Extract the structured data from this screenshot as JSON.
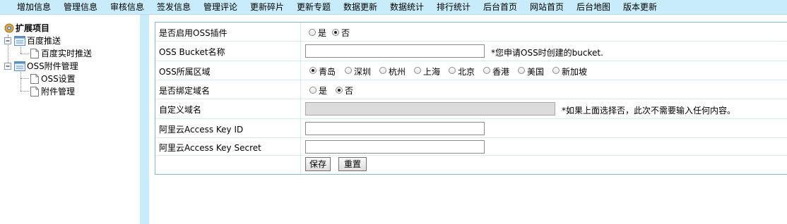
{
  "topnav": {
    "items": [
      "增加信息",
      "管理信息",
      "审核信息",
      "签发信息",
      "管理评论",
      "更新碎片",
      "更新专题",
      "数据更新",
      "数据统计",
      "排行统计",
      "后台首页",
      "网站首页",
      "后台地图",
      "版本更新"
    ]
  },
  "sidebar": {
    "root": "扩展项目",
    "groups": [
      {
        "label": "百度推送",
        "children": [
          "百度实时推送"
        ]
      },
      {
        "label": "OSS附件管理",
        "children": [
          "OSS设置",
          "附件管理"
        ]
      }
    ]
  },
  "form": {
    "rows": {
      "enable_oss": {
        "label": "是否启用OSS插件",
        "options": [
          "是",
          "否"
        ],
        "selected": "否"
      },
      "bucket": {
        "label": "OSS Bucket名称",
        "value": "",
        "hint": "*您申请OSS时创建的bucket."
      },
      "region": {
        "label": "OSS所属区域",
        "options": [
          "青岛",
          "深圳",
          "杭州",
          "上海",
          "北京",
          "香港",
          "美国",
          "新加坡"
        ],
        "selected": "青岛"
      },
      "bind_domain": {
        "label": "是否绑定域名",
        "options": [
          "是",
          "否"
        ],
        "selected": "否"
      },
      "custom_domain": {
        "label": "自定义域名",
        "value": "",
        "hint": "*如果上面选择否，此次不需要输入任何内容。"
      },
      "access_key_id": {
        "label": "阿里云Access Key ID",
        "value": ""
      },
      "access_key_secret": {
        "label": "阿里云Access Key Secret",
        "value": ""
      }
    },
    "save_label": "保存",
    "reset_label": "重置"
  }
}
